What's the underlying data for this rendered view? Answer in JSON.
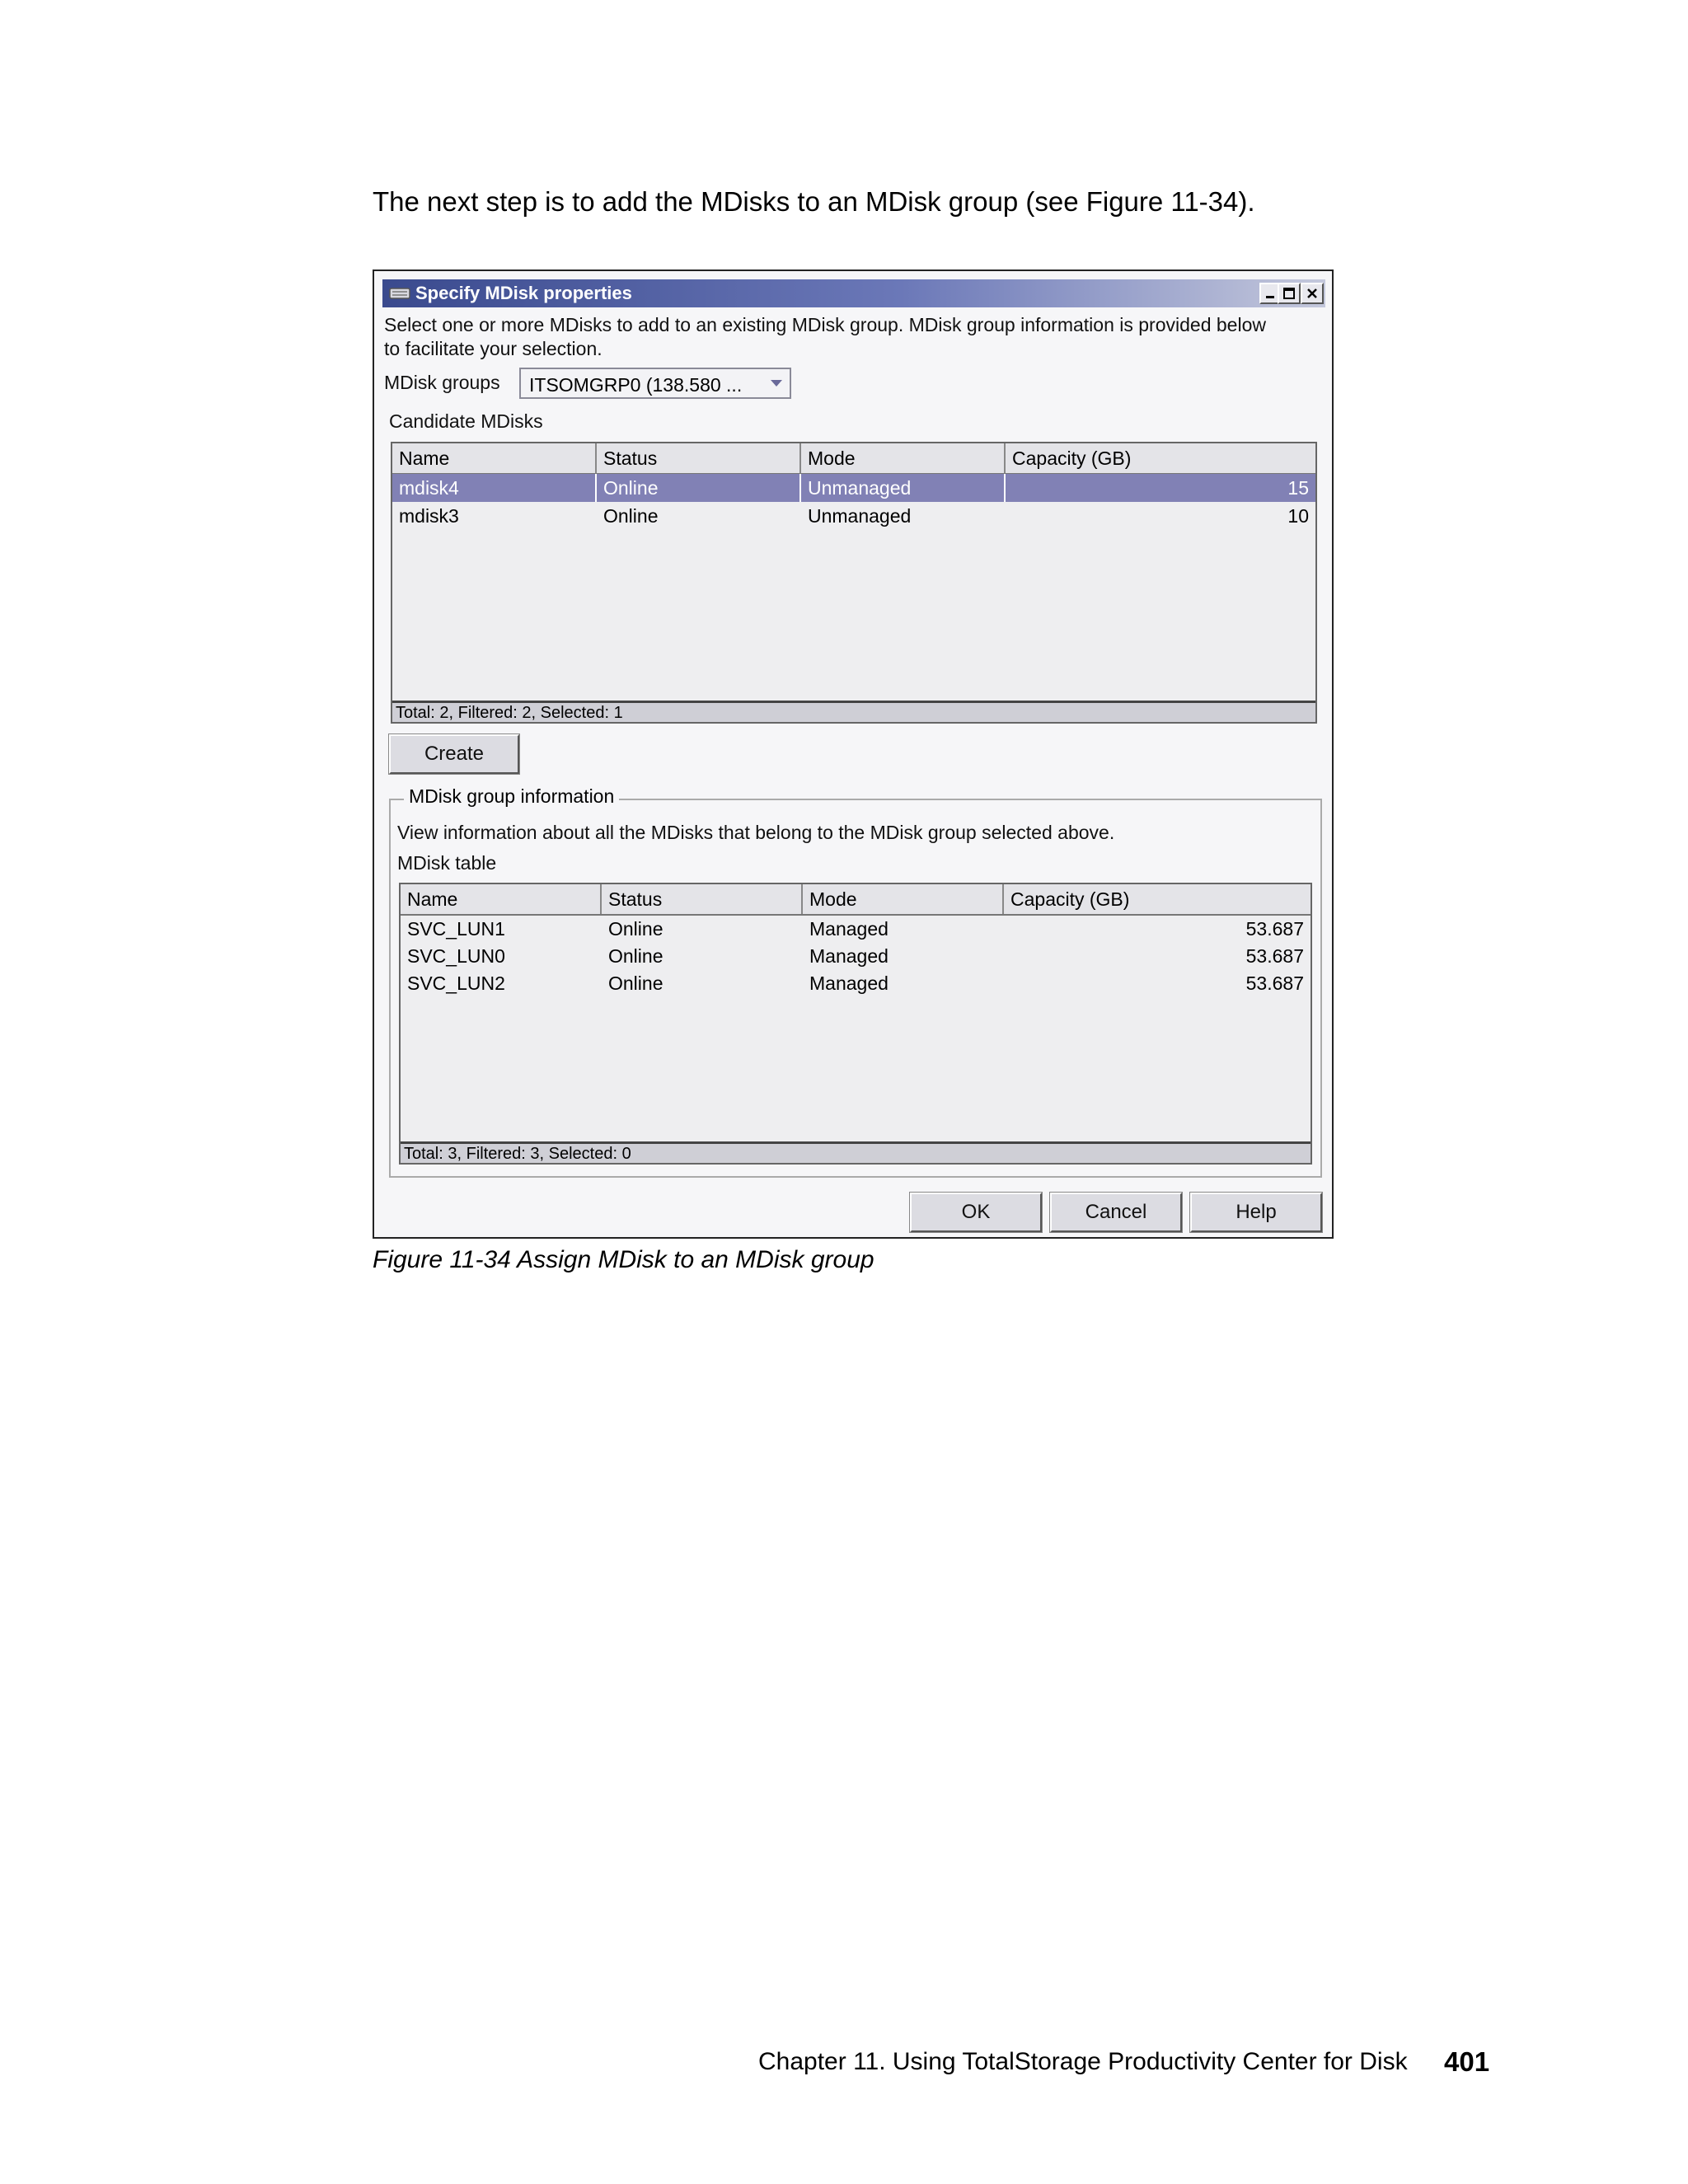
{
  "intro": "The next step is to add the MDisks to an MDisk group (see Figure 11-34).",
  "dialog": {
    "title": "Specify MDisk properties",
    "instructions_line1": "Select one or more MDisks to add to an existing MDisk group. MDisk group information is provided below",
    "instructions_line2": "to facilitate your selection.",
    "groups_label": "MDisk groups",
    "groups_selected": "ITSOMGRP0 (138.580 ...",
    "candidate_label": "Candidate MDisks",
    "candidate_table": {
      "headers": [
        "Name",
        "Status",
        "Mode",
        "Capacity (GB)"
      ],
      "rows": [
        {
          "name": "mdisk4",
          "status": "Online",
          "mode": "Unmanaged",
          "capacity": "15",
          "selected": true
        },
        {
          "name": "mdisk3",
          "status": "Online",
          "mode": "Unmanaged",
          "capacity": "10",
          "selected": false
        }
      ],
      "footer": "Total: 2, Filtered: 2, Selected: 1"
    },
    "create_label": "Create",
    "group_info": {
      "legend": "MDisk group information",
      "description": "View information about all the MDisks that belong to the MDisk group selected above.",
      "table_label": "MDisk table",
      "table": {
        "headers": [
          "Name",
          "Status",
          "Mode",
          "Capacity (GB)"
        ],
        "rows": [
          {
            "name": "SVC_LUN1",
            "status": "Online",
            "mode": "Managed",
            "capacity": "53.687"
          },
          {
            "name": "SVC_LUN0",
            "status": "Online",
            "mode": "Managed",
            "capacity": "53.687"
          },
          {
            "name": "SVC_LUN2",
            "status": "Online",
            "mode": "Managed",
            "capacity": "53.687"
          }
        ],
        "footer": "Total: 3, Filtered: 3, Selected: 0"
      }
    },
    "ok_label": "OK",
    "cancel_label": "Cancel",
    "help_label": "Help",
    "icons": {
      "window": "app-window-icon",
      "minimize": "minimize-icon",
      "maximize": "maximize-icon",
      "close": "close-icon",
      "dropdown": "chevron-down-icon"
    }
  },
  "caption": "Figure 11-34   Assign MDisk to an MDisk group",
  "page_footer": "Chapter 11. Using TotalStorage Productivity Center for Disk",
  "page_number": "401",
  "colors": {
    "title_bar": "#3a4a8e",
    "selected_row": "#8181b5"
  }
}
